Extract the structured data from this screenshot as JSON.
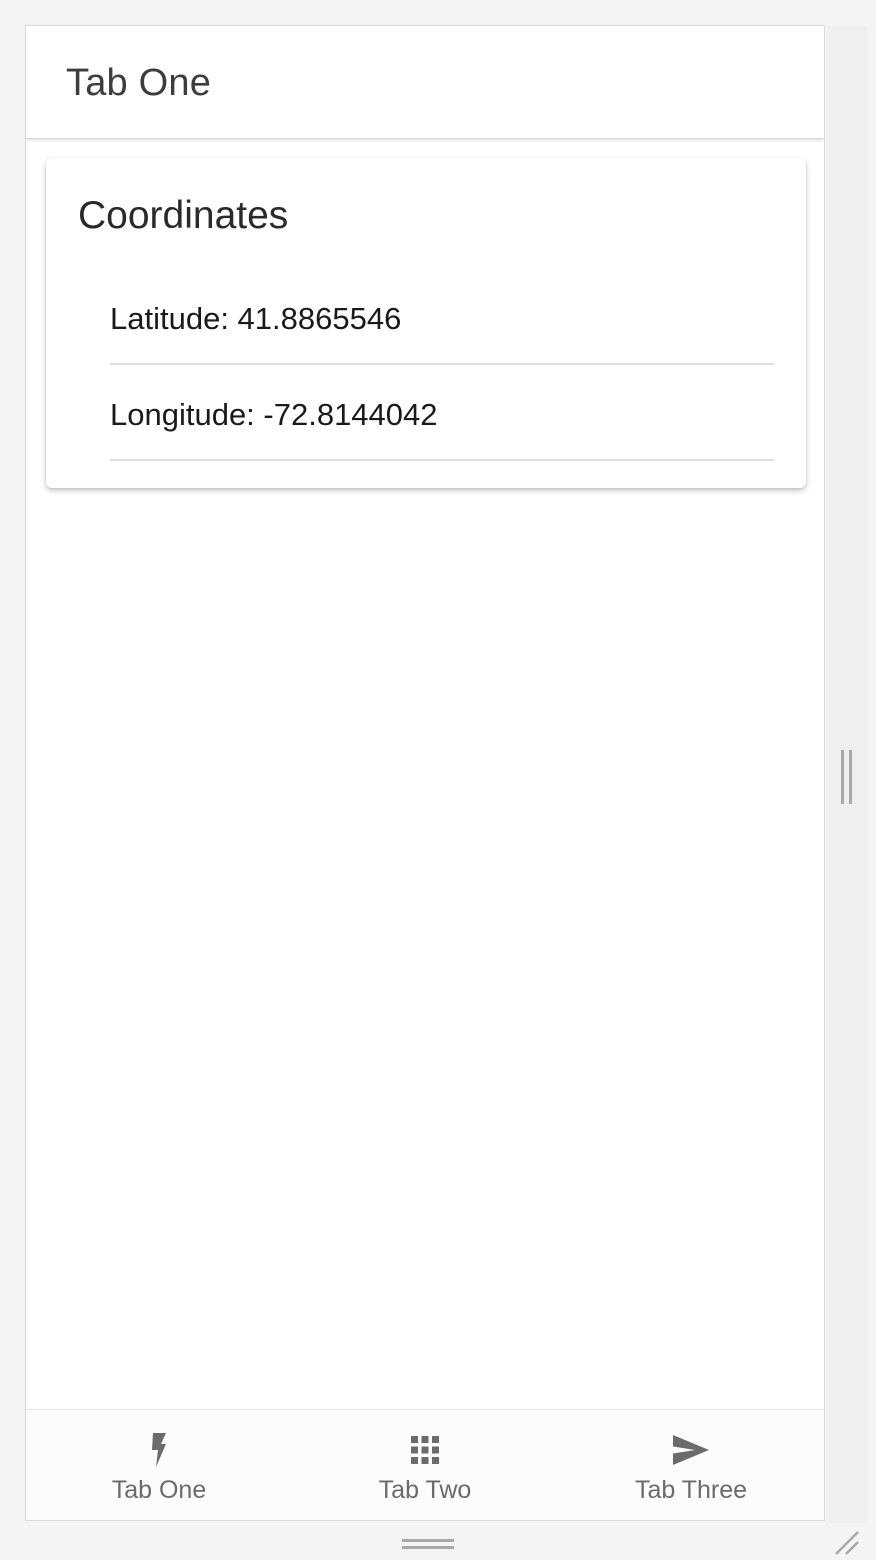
{
  "header": {
    "title": "Tab One"
  },
  "card": {
    "title": "Coordinates",
    "rows": [
      {
        "label": "Latitude: 41.8865546"
      },
      {
        "label": "Longitude: -72.8144042"
      }
    ]
  },
  "tabs": [
    {
      "label": "Tab One",
      "icon": "flash-icon"
    },
    {
      "label": "Tab Two",
      "icon": "apps-grid-icon"
    },
    {
      "label": "Tab Three",
      "icon": "send-icon"
    }
  ],
  "colors": {
    "background": "#f4f4f4",
    "surface": "#ffffff",
    "tab_icon": "#6b6b6b",
    "divider": "#dedede"
  }
}
